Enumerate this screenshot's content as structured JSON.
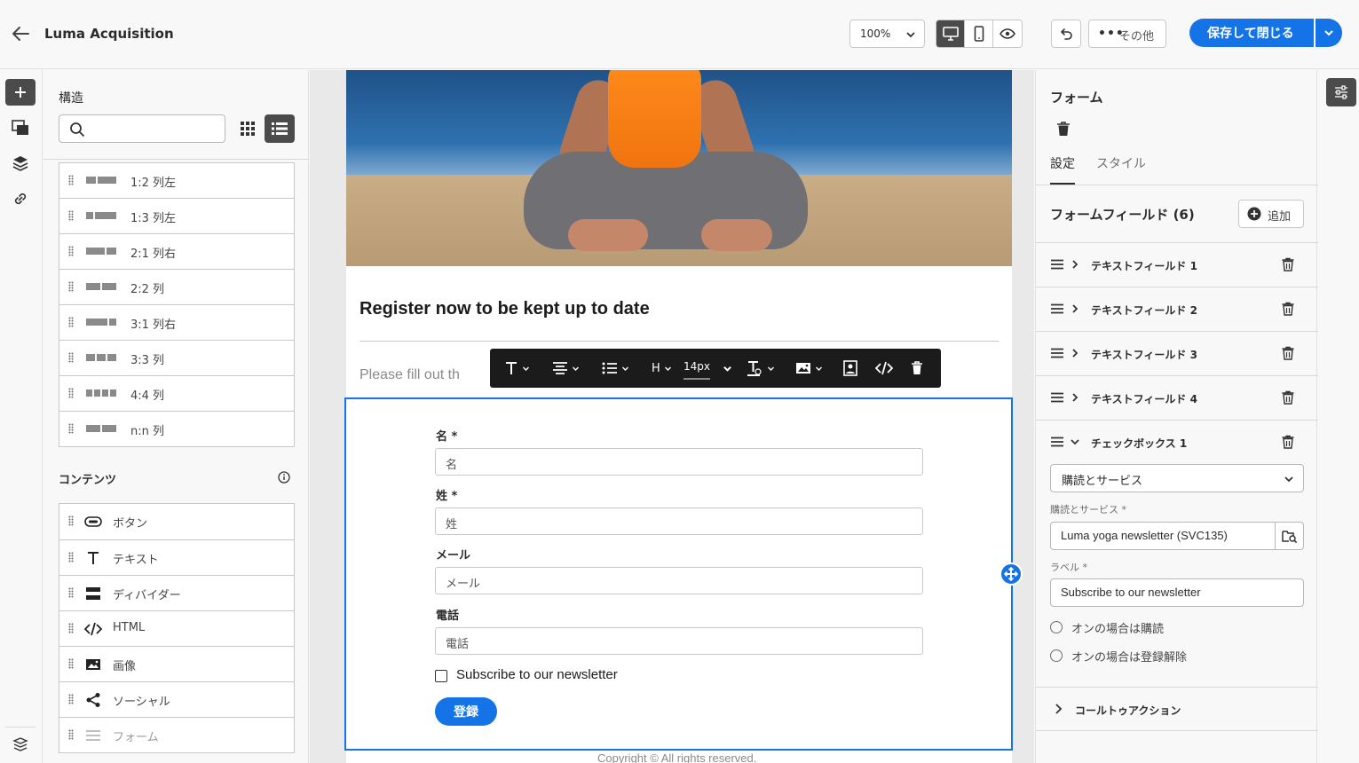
{
  "header": {
    "title": "Luma Acquisition",
    "zoom": "100%",
    "more_label": "その他",
    "save_label": "保存して閉じる"
  },
  "structure": {
    "title": "構造",
    "search_placeholder": "",
    "items": [
      {
        "label": "1:2 列左",
        "cols": [
          1,
          2
        ]
      },
      {
        "label": "1:3 列左",
        "cols": [
          1,
          3
        ]
      },
      {
        "label": "2:1 列右",
        "cols": [
          2,
          1
        ]
      },
      {
        "label": "2:2 列",
        "cols": [
          2,
          2
        ]
      },
      {
        "label": "3:1 列右",
        "cols": [
          3,
          1
        ]
      },
      {
        "label": "3:3 列",
        "cols": [
          1,
          1,
          1
        ]
      },
      {
        "label": "4:4 列",
        "cols": [
          1,
          1,
          1,
          1
        ]
      },
      {
        "label": "n:n 列",
        "cols": [
          1,
          1
        ]
      }
    ]
  },
  "contents": {
    "title": "コンテンツ",
    "items": [
      {
        "label": "ボタン",
        "icon": "button-icon"
      },
      {
        "label": "テキスト",
        "icon": "text-icon"
      },
      {
        "label": "ディバイダー",
        "icon": "divider-icon"
      },
      {
        "label": "HTML",
        "icon": "code-icon"
      },
      {
        "label": "画像",
        "icon": "image-icon"
      },
      {
        "label": "ソーシャル",
        "icon": "share-icon"
      },
      {
        "label": "フォーム",
        "icon": "form-icon",
        "disabled": true
      }
    ]
  },
  "email": {
    "heading": "Register now to be kept up to date",
    "intro": "Please fill out th",
    "toolbar": {
      "heading_label": "H",
      "font_size": "14px"
    },
    "form": {
      "fields": [
        {
          "label": "名 *",
          "placeholder": "名"
        },
        {
          "label": "姓 *",
          "placeholder": "姓"
        },
        {
          "label": "メール",
          "placeholder": "メール"
        },
        {
          "label": "電話",
          "placeholder": "電話"
        }
      ],
      "checkbox_label": "Subscribe to our newsletter",
      "submit_label": "登録"
    },
    "footer": "Copyright ©  All rights reserved."
  },
  "inspector": {
    "title": "フォーム",
    "tabs": [
      {
        "label": "設定",
        "active": true
      },
      {
        "label": "スタイル",
        "active": false
      }
    ],
    "fields_title": "フォームフィールド (6)",
    "add_label": "追加",
    "fields": [
      {
        "label": "テキストフィールド 1",
        "expanded": false
      },
      {
        "label": "テキストフィールド 2",
        "expanded": false
      },
      {
        "label": "テキストフィールド 3",
        "expanded": false
      },
      {
        "label": "テキストフィールド 4",
        "expanded": false
      },
      {
        "label": "チェックボックス 1",
        "expanded": true
      }
    ],
    "checkbox_config": {
      "type_select": "購読とサービス",
      "service_label": "購読とサービス",
      "service_value": "Luma yoga newsletter (SVC135)",
      "label_label": "ラベル",
      "label_value": "Subscribe to our newsletter",
      "radio_on_subscribe": "オンの場合は購読",
      "radio_on_unsubscribe": "オンの場合は登録解除"
    },
    "cta_label": "コールトゥアクション"
  },
  "colors": {
    "accent": "#1473e6",
    "dark": "#4b4b4b",
    "toolbar": "#1b1b1b"
  }
}
